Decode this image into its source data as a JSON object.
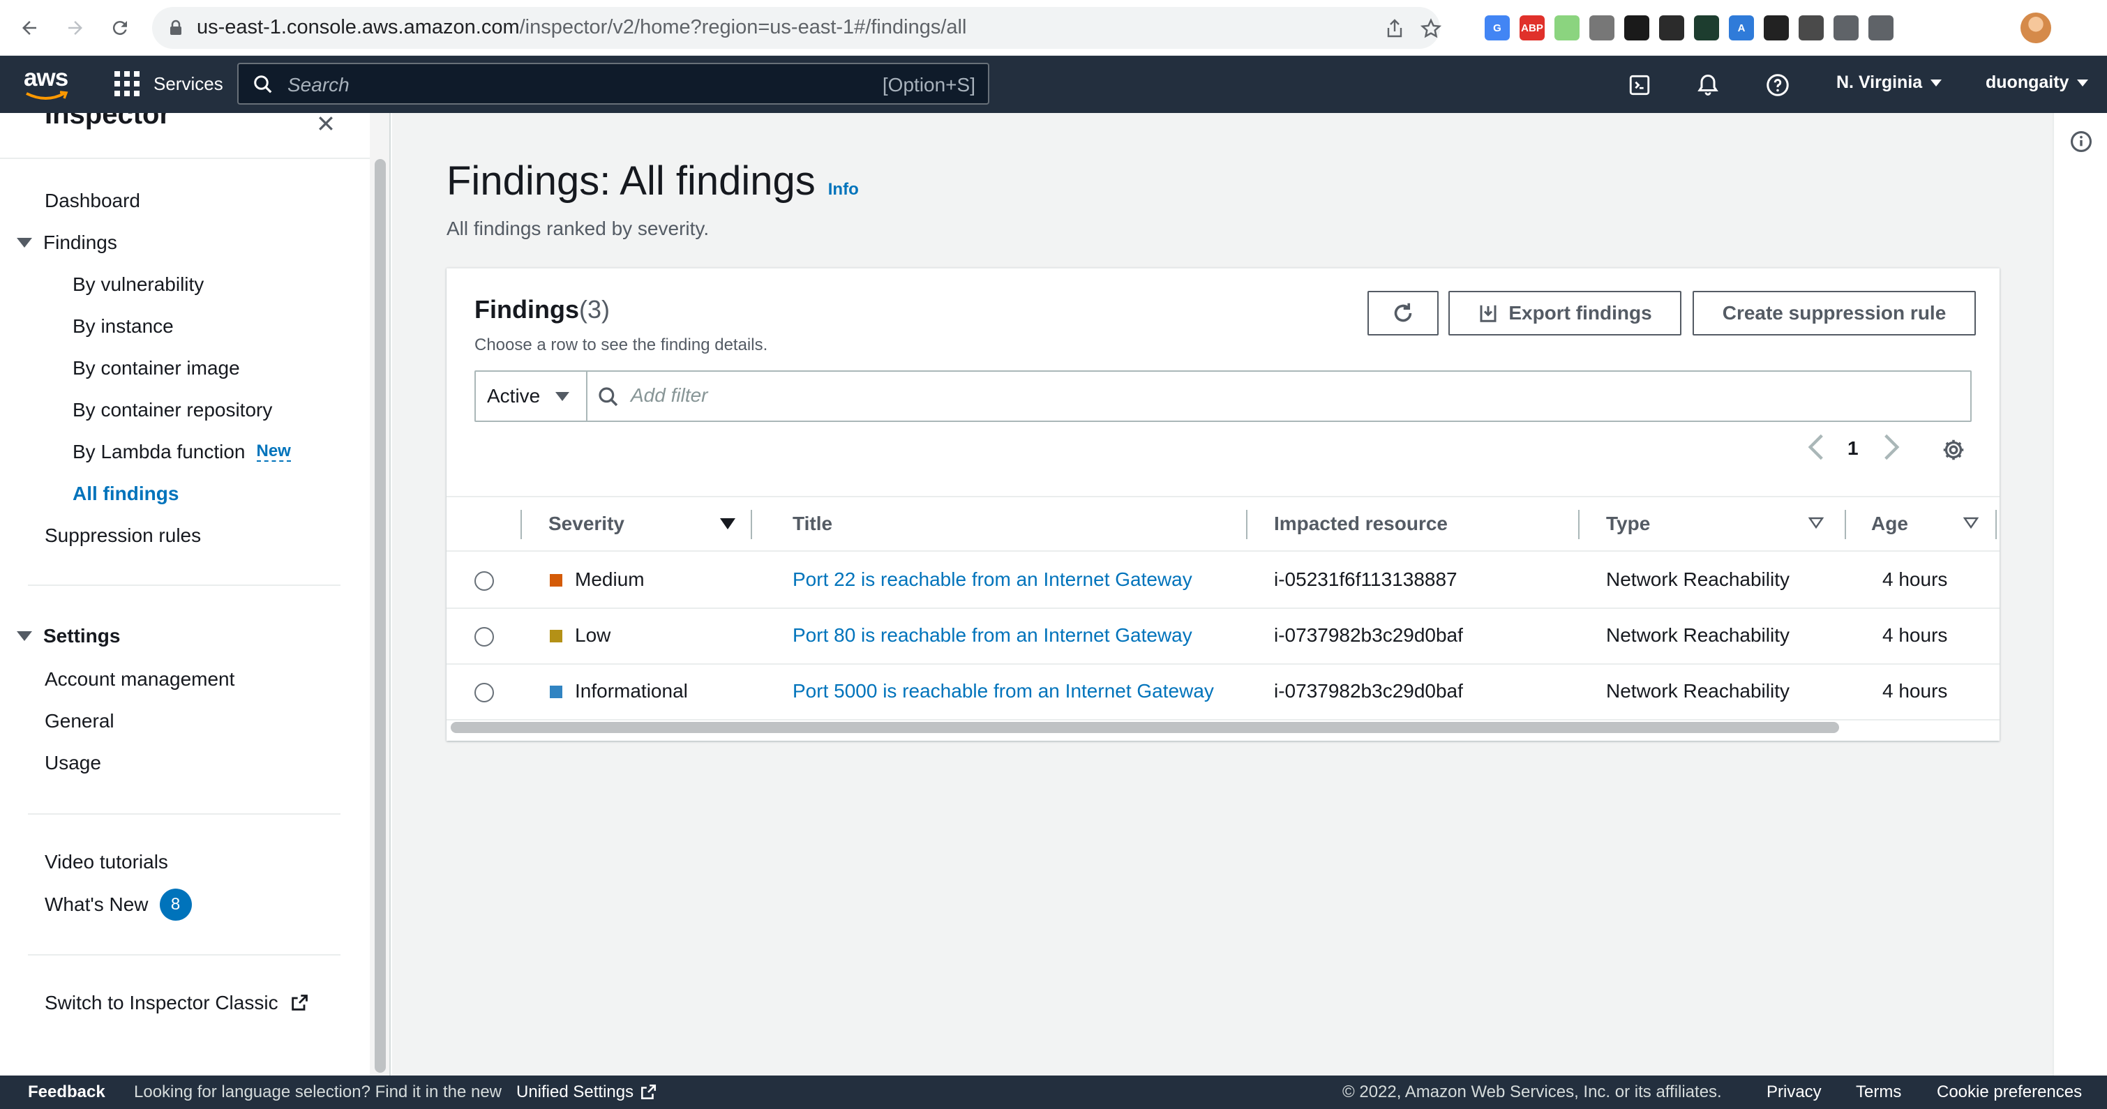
{
  "browser": {
    "url_host": "us-east-1.console.aws.amazon.com",
    "url_path": "/inspector/v2/home?region=us-east-1#/findings/all",
    "extensions": [
      {
        "icon": "translate-icon",
        "color": "#4285f4",
        "label": "G"
      },
      {
        "icon": "adblock-icon",
        "color": "#e0312b",
        "label": "ABP"
      },
      {
        "icon": "color-picker-icon",
        "color": "#8bd47f",
        "label": ""
      },
      {
        "icon": "camera-icon",
        "color": "#777777",
        "label": ""
      },
      {
        "icon": "adobe-icon",
        "color": "#1a1a1a",
        "label": ""
      },
      {
        "icon": "mask-icon",
        "color": "#2b2b2b",
        "label": ""
      },
      {
        "icon": "cursor-icon",
        "color": "#1d3d2f",
        "label": ""
      },
      {
        "icon": "font-icon",
        "color": "#2f7bd9",
        "label": "A"
      },
      {
        "icon": "css-icon",
        "color": "#222222",
        "label": ""
      },
      {
        "icon": "head-icon",
        "color": "#4a4a4a",
        "label": ""
      },
      {
        "icon": "puzzle-icon",
        "color": "#5f6368",
        "label": ""
      },
      {
        "icon": "sidepanel-icon",
        "color": "#5f6368",
        "label": ""
      }
    ]
  },
  "aws_nav": {
    "logo_text": "aws",
    "services_label": "Services",
    "search_placeholder": "Search",
    "search_shortcut": "[Option+S]",
    "region": "N. Virginia",
    "user": "duongaity"
  },
  "sidebar": {
    "title": "Inspector",
    "items": {
      "dashboard": "Dashboard",
      "findings": "Findings",
      "by_vulnerability": "By vulnerability",
      "by_instance": "By instance",
      "by_container_image": "By container image",
      "by_container_repository": "By container repository",
      "by_lambda_function": "By Lambda function",
      "new_badge": "New",
      "all_findings": "All findings",
      "suppression_rules": "Suppression rules",
      "settings": "Settings",
      "account_management": "Account management",
      "general": "General",
      "usage": "Usage",
      "video_tutorials": "Video tutorials",
      "whats_new": "What's New",
      "whats_new_count": "8",
      "switch_classic": "Switch to Inspector Classic"
    }
  },
  "main": {
    "title": "Findings: All findings",
    "info_link": "Info",
    "description": "All findings ranked by severity.",
    "card": {
      "title": "Findings",
      "count": "(3)",
      "description": "Choose a row to see the finding details.",
      "refresh_label": "",
      "export_label": "Export findings",
      "suppression_label": "Create suppression rule",
      "filter_status": "Active",
      "filter_placeholder": "Add filter",
      "page_number": "1"
    },
    "columns": {
      "severity": "Severity",
      "title": "Title",
      "impacted_resource": "Impacted resource",
      "type": "Type",
      "age": "Age"
    },
    "rows": [
      {
        "severity": "Medium",
        "severity_color": "#d45b07",
        "title": "Port 22 is reachable from an Internet Gateway",
        "resource": "i-05231f6f113138887",
        "type": "Network Reachability",
        "age": "4 hours"
      },
      {
        "severity": "Low",
        "severity_color": "#b49116",
        "title": "Port 80 is reachable from an Internet Gateway",
        "resource": "i-0737982b3c29d0baf",
        "type": "Network Reachability",
        "age": "4 hours"
      },
      {
        "severity": "Informational",
        "severity_color": "#3184c2",
        "title": "Port 5000 is reachable from an Internet Gateway",
        "resource": "i-0737982b3c29d0baf",
        "type": "Network Reachability",
        "age": "4 hours"
      }
    ]
  },
  "footer": {
    "feedback": "Feedback",
    "language_text": "Looking for language selection? Find it in the new",
    "unified_settings": "Unified Settings",
    "copyright": "© 2022, Amazon Web Services, Inc. or its affiliates.",
    "privacy": "Privacy",
    "terms": "Terms",
    "cookie": "Cookie preferences"
  }
}
